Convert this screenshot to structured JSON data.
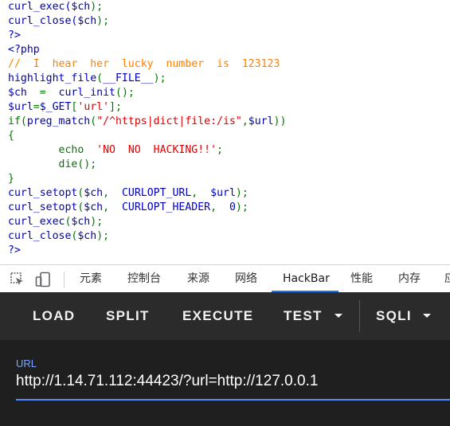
{
  "code": {
    "lines": [
      [
        {
          "t": "curl_exec(",
          "c": "def"
        },
        {
          "t": "$ch",
          "c": "def"
        },
        {
          "t": ");",
          "c": "kw"
        }
      ],
      [
        {
          "t": "curl_close(",
          "c": "def"
        },
        {
          "t": "$ch",
          "c": "def"
        },
        {
          "t": ");",
          "c": "kw"
        }
      ],
      [
        {
          "t": "?>",
          "c": "blk"
        }
      ],
      [
        {
          "t": "<?php",
          "c": "blk"
        }
      ],
      [
        {
          "t": "//  I  hear  her  lucky  number  is  123123",
          "c": "com"
        }
      ],
      [
        {
          "t": "highlight_file",
          "c": "def"
        },
        {
          "t": "(",
          "c": "kw"
        },
        {
          "t": "__FILE__",
          "c": "def"
        },
        {
          "t": ");",
          "c": "kw"
        }
      ],
      [
        {
          "t": "$ch  ",
          "c": "def"
        },
        {
          "t": "=  ",
          "c": "kw"
        },
        {
          "t": "curl_init",
          "c": "def"
        },
        {
          "t": "();",
          "c": "kw"
        }
      ],
      [
        {
          "t": "$url",
          "c": "def"
        },
        {
          "t": "=",
          "c": "kw"
        },
        {
          "t": "$_GET",
          "c": "def"
        },
        {
          "t": "[",
          "c": "kw"
        },
        {
          "t": "'url'",
          "c": "str"
        },
        {
          "t": "];",
          "c": "kw"
        }
      ],
      [
        {
          "t": "if(",
          "c": "kw"
        },
        {
          "t": "preg_match",
          "c": "def"
        },
        {
          "t": "(",
          "c": "kw"
        },
        {
          "t": "\"/^https|dict|file:/is\"",
          "c": "str"
        },
        {
          "t": ",",
          "c": "kw"
        },
        {
          "t": "$url",
          "c": "def"
        },
        {
          "t": "))",
          "c": "kw"
        }
      ],
      [
        {
          "t": "{",
          "c": "kw"
        }
      ],
      [
        {
          "t": "        ",
          "c": "kw"
        },
        {
          "t": "echo  ",
          "c": "kw"
        },
        {
          "t": "'NO  NO  HACKING!!'",
          "c": "str"
        },
        {
          "t": ";",
          "c": "kw"
        }
      ],
      [
        {
          "t": "        ",
          "c": "kw"
        },
        {
          "t": "die",
          "c": "kw"
        },
        {
          "t": "();",
          "c": "kw"
        }
      ],
      [
        {
          "t": "}",
          "c": "kw"
        }
      ],
      [
        {
          "t": "curl_setopt",
          "c": "def"
        },
        {
          "t": "(",
          "c": "kw"
        },
        {
          "t": "$ch",
          "c": "def"
        },
        {
          "t": ",  ",
          "c": "kw"
        },
        {
          "t": "CURLOPT_URL",
          "c": "def"
        },
        {
          "t": ",  ",
          "c": "kw"
        },
        {
          "t": "$url",
          "c": "def"
        },
        {
          "t": ");",
          "c": "kw"
        }
      ],
      [
        {
          "t": "curl_setopt",
          "c": "def"
        },
        {
          "t": "(",
          "c": "kw"
        },
        {
          "t": "$ch",
          "c": "def"
        },
        {
          "t": ",  ",
          "c": "kw"
        },
        {
          "t": "CURLOPT_HEADER",
          "c": "def"
        },
        {
          "t": ",  ",
          "c": "kw"
        },
        {
          "t": "0",
          "c": "def"
        },
        {
          "t": ");",
          "c": "kw"
        }
      ],
      [
        {
          "t": "curl_exec",
          "c": "def"
        },
        {
          "t": "(",
          "c": "kw"
        },
        {
          "t": "$ch",
          "c": "def"
        },
        {
          "t": ");",
          "c": "kw"
        }
      ],
      [
        {
          "t": "curl_close",
          "c": "def"
        },
        {
          "t": "(",
          "c": "kw"
        },
        {
          "t": "$ch",
          "c": "def"
        },
        {
          "t": ");",
          "c": "kw"
        }
      ],
      [
        {
          "t": "?>",
          "c": "blk"
        }
      ]
    ]
  },
  "devtools": {
    "icons": [
      "inspect-element-icon",
      "device-toolbar-icon"
    ],
    "tabs": [
      {
        "label": "元素"
      },
      {
        "label": "控制台"
      },
      {
        "label": "来源"
      },
      {
        "label": "网络"
      },
      {
        "label": "HackBar",
        "active": true
      },
      {
        "label": "性能"
      },
      {
        "label": "内存"
      },
      {
        "label": "应"
      }
    ]
  },
  "hackbar": {
    "buttons": {
      "load": "LOAD",
      "split": "SPLIT",
      "execute": "EXECUTE",
      "test": "TEST",
      "sqli": "SQLI"
    },
    "url_label": "URL",
    "url_value": "http://1.14.71.112:44423/?url=http://127.0.0.1"
  },
  "colors": {
    "php_default": "#0000bb",
    "php_keyword": "#007700",
    "php_string": "#dd0000",
    "php_comment": "#ff8000",
    "devtools_active_tab": "#1a73e8",
    "hackbar_toolbar_bg": "#2b2b2b",
    "hackbar_body_bg": "#1f1f1f",
    "hackbar_accent": "#4d8dff"
  }
}
